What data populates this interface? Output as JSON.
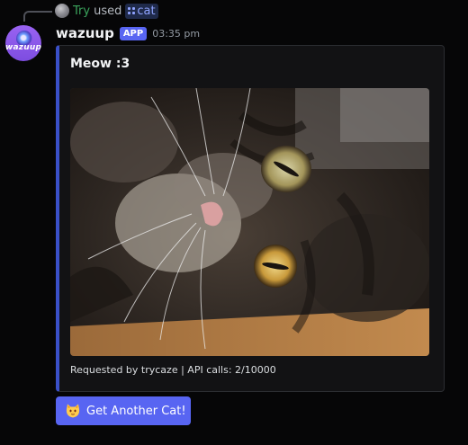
{
  "reply": {
    "user": "Try",
    "action": "used",
    "command": "cat"
  },
  "message": {
    "avatar_text": "wazuup",
    "username": "wazuup",
    "badge": "APP",
    "timestamp": "03:35 pm"
  },
  "embed": {
    "title": "Meow :3",
    "image_alt": "tabby cat lying on its back",
    "footer": "Requested by trycaze | API calls: 2/10000",
    "accent_color": "#3a50c8"
  },
  "button": {
    "label": "Get Another Cat!",
    "icon": "cat-face-emoji",
    "color": "#5865f2"
  }
}
